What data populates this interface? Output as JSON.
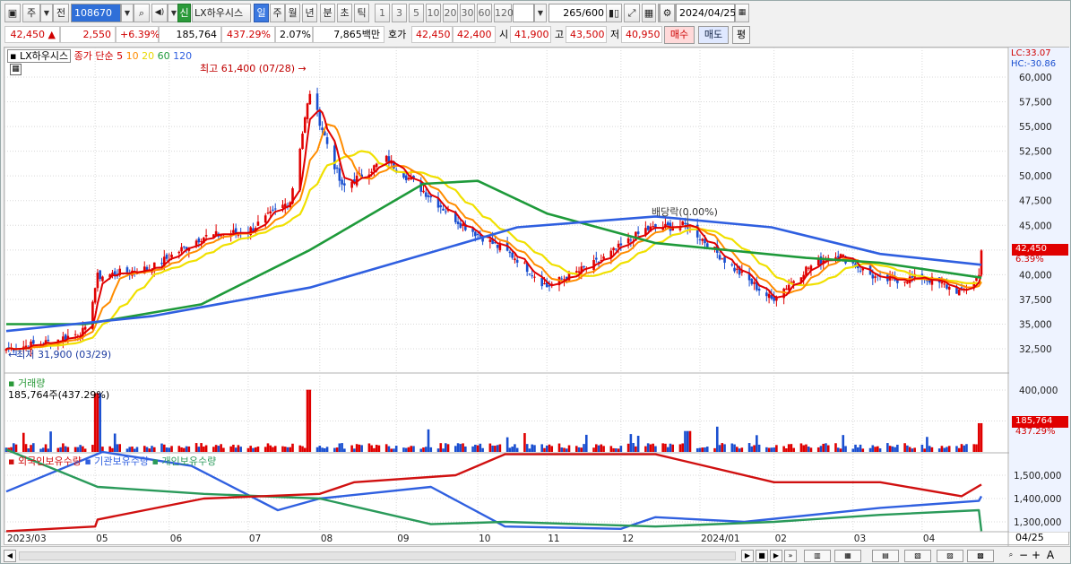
{
  "toolbar": {
    "mode": "주",
    "prev": "전",
    "code": "108670",
    "speaker": "◀)",
    "new_badge": "신",
    "stock_name": "LX하우시스",
    "periods": [
      "일",
      "주",
      "월",
      "년",
      "분",
      "초",
      "틱"
    ],
    "active_period": "일",
    "intervals": [
      "1",
      "3",
      "5",
      "10",
      "20",
      "30",
      "60",
      "120"
    ],
    "count": "265",
    "total": "/600",
    "date": "2024/04/25"
  },
  "quote": {
    "price": "42,450",
    "arrow": "▲",
    "change": "2,550",
    "change_pct": "+6.39%",
    "volume": "185,764",
    "vol_pct": "437.29%",
    "turnover_pct": "2.07%",
    "amount": "7,865백만",
    "hoga_label": "호가",
    "ask": "42,450",
    "bid": "42,400",
    "open_label": "시",
    "open": "41,900",
    "high_label": "고",
    "high": "43,500",
    "low_label": "저",
    "low": "40,950",
    "buy_label": "매수",
    "sell_label": "매도",
    "eval_label": "평"
  },
  "legend": {
    "name": "LX하우시스",
    "price_label": "종가",
    "ma_label": "단순",
    "mas": [
      "5",
      "10",
      "20",
      "60",
      "120"
    ],
    "high_note": "최고 61,400 (07/28)",
    "low_note": "최저 31,900 (03/29)",
    "dividend_note": "배당락(0.00%)"
  },
  "right_axis": {
    "lc": "LC:33.07",
    "hc": "HC:-30.86",
    "last_price": "42,450",
    "last_pct": "6.39%",
    "last_vol": "185,764",
    "last_vol_pct": "437.29%"
  },
  "volume_panel": {
    "title": "거래량",
    "value": "185,764주(437.29%)"
  },
  "holding_panel": {
    "titles": [
      "외국인보유수량",
      "기관보유수량",
      "개인보유수량"
    ]
  },
  "x_axis": {
    "labels": [
      "2023/03",
      "05",
      "06",
      "07",
      "08",
      "09",
      "10",
      "11",
      "12",
      "2024/01",
      "02",
      "03",
      "04"
    ],
    "right_label": "04/25"
  },
  "colors": {
    "up": "#e00000",
    "down": "#1a4fd0",
    "ma5": "#e00000",
    "ma10": "#ff8c00",
    "ma20": "#f0e000",
    "ma60": "#1e9a3a",
    "ma120": "#2f5fe0",
    "foreign": "#d01010",
    "inst": "#3060e0",
    "retail": "#2a9a5a"
  },
  "chart_data": {
    "type": "candlestick",
    "price_ticks": [
      "60,000",
      "57,500",
      "55,000",
      "52,500",
      "50,000",
      "47,500",
      "45,000",
      "42,500",
      "40,000",
      "37,500",
      "35,000",
      "32,500"
    ],
    "volume_ticks": [
      "400,000",
      "200,000"
    ],
    "holding_ticks": [
      "1,500,000",
      "1,400,000",
      "1,300,000"
    ],
    "anchors": [
      {
        "date": "2023/03/27",
        "close": 32500
      },
      {
        "date": "2023/04/14",
        "close": 33200
      },
      {
        "date": "2023/04/28",
        "close": 34300
      },
      {
        "date": "2023/05/03",
        "close": 39800
      },
      {
        "date": "2023/05/25",
        "close": 40700
      },
      {
        "date": "2023/06/14",
        "close": 43800
      },
      {
        "date": "2023/07/03",
        "close": 44400
      },
      {
        "date": "2023/07/20",
        "close": 47500
      },
      {
        "date": "2023/07/28",
        "close": 58500
      },
      {
        "date": "2023/08/10",
        "close": 48800
      },
      {
        "date": "2023/08/28",
        "close": 51700
      },
      {
        "date": "2023/09/12",
        "close": 48500
      },
      {
        "date": "2023/09/27",
        "close": 45200
      },
      {
        "date": "2023/10/20",
        "close": 41600
      },
      {
        "date": "2023/11/01",
        "close": 38800
      },
      {
        "date": "2023/11/22",
        "close": 41300
      },
      {
        "date": "2023/12/11",
        "close": 44600
      },
      {
        "date": "2023/12/28",
        "close": 45000
      },
      {
        "date": "2024/01/15",
        "close": 40800
      },
      {
        "date": "2024/01/31",
        "close": 37500
      },
      {
        "date": "2024/02/14",
        "close": 40600
      },
      {
        "date": "2024/02/26",
        "close": 42200
      },
      {
        "date": "2024/03/15",
        "close": 39400
      },
      {
        "date": "2024/04/02",
        "close": 39700
      },
      {
        "date": "2024/04/17",
        "close": 38200
      },
      {
        "date": "2024/04/24",
        "close": 39900
      },
      {
        "date": "2024/04/25",
        "close": 42450
      }
    ],
    "ma120": [
      {
        "date": "2023/03/27",
        "v": 34300
      },
      {
        "date": "2023/05/25",
        "v": 35800
      },
      {
        "date": "2023/07/28",
        "v": 38700
      },
      {
        "date": "2023/10/20",
        "v": 44800
      },
      {
        "date": "2023/12/15",
        "v": 45900
      },
      {
        "date": "2024/01/31",
        "v": 44800
      },
      {
        "date": "2024/03/15",
        "v": 42100
      },
      {
        "date": "2024/04/25",
        "v": 41000
      }
    ],
    "ma60": [
      {
        "date": "2023/03/27",
        "v": 35000
      },
      {
        "date": "2023/04/28",
        "v": 35000
      },
      {
        "date": "2023/06/14",
        "v": 37000
      },
      {
        "date": "2023/07/28",
        "v": 42500
      },
      {
        "date": "2023/09/12",
        "v": 49200
      },
      {
        "date": "2023/10/04",
        "v": 49500
      },
      {
        "date": "2023/11/01",
        "v": 46200
      },
      {
        "date": "2023/12/15",
        "v": 43200
      },
      {
        "date": "2024/02/14",
        "v": 41700
      },
      {
        "date": "2024/03/15",
        "v": 41200
      },
      {
        "date": "2024/04/25",
        "v": 39700
      }
    ],
    "volume_spikes": [
      {
        "date": "2023/05/03",
        "v": 380000
      },
      {
        "date": "2023/07/28",
        "v": 402000
      },
      {
        "date": "2023/12/28",
        "v": 135000
      },
      {
        "date": "2024/04/25",
        "v": 185764
      }
    ],
    "holdings": {
      "foreign": [
        {
          "date": "2023/03/27",
          "v": 1260000
        },
        {
          "date": "2023/05/02",
          "v": 1280000
        },
        {
          "date": "2023/05/03",
          "v": 1310000
        },
        {
          "date": "2023/06/15",
          "v": 1400000
        },
        {
          "date": "2023/08/01",
          "v": 1420000
        },
        {
          "date": "2023/08/15",
          "v": 1470000
        },
        {
          "date": "2023/09/25",
          "v": 1500000
        },
        {
          "date": "2023/10/15",
          "v": 1590000
        },
        {
          "date": "2023/12/15",
          "v": 1590000
        },
        {
          "date": "2024/02/01",
          "v": 1470000
        },
        {
          "date": "2024/03/15",
          "v": 1470000
        },
        {
          "date": "2024/04/17",
          "v": 1410000
        },
        {
          "date": "2024/04/25",
          "v": 1460000
        }
      ],
      "inst": [
        {
          "date": "2023/03/27",
          "v": 1430000
        },
        {
          "date": "2023/05/05",
          "v": 1600000
        },
        {
          "date": "2023/06/10",
          "v": 1540000
        },
        {
          "date": "2023/07/15",
          "v": 1350000
        },
        {
          "date": "2023/08/01",
          "v": 1400000
        },
        {
          "date": "2023/09/15",
          "v": 1450000
        },
        {
          "date": "2023/10/15",
          "v": 1280000
        },
        {
          "date": "2023/12/01",
          "v": 1270000
        },
        {
          "date": "2023/12/15",
          "v": 1320000
        },
        {
          "date": "2024/01/20",
          "v": 1300000
        },
        {
          "date": "2024/03/15",
          "v": 1360000
        },
        {
          "date": "2024/04/24",
          "v": 1390000
        },
        {
          "date": "2024/04/25",
          "v": 1410000
        }
      ],
      "retail": [
        {
          "date": "2023/03/27",
          "v": 1610000
        },
        {
          "date": "2023/05/03",
          "v": 1450000
        },
        {
          "date": "2023/06/15",
          "v": 1420000
        },
        {
          "date": "2023/08/01",
          "v": 1400000
        },
        {
          "date": "2023/09/15",
          "v": 1290000
        },
        {
          "date": "2023/10/15",
          "v": 1300000
        },
        {
          "date": "2023/12/15",
          "v": 1280000
        },
        {
          "date": "2024/02/01",
          "v": 1300000
        },
        {
          "date": "2024/03/15",
          "v": 1330000
        },
        {
          "date": "2024/04/24",
          "v": 1350000
        },
        {
          "date": "2024/04/25",
          "v": 1260000
        }
      ]
    }
  }
}
